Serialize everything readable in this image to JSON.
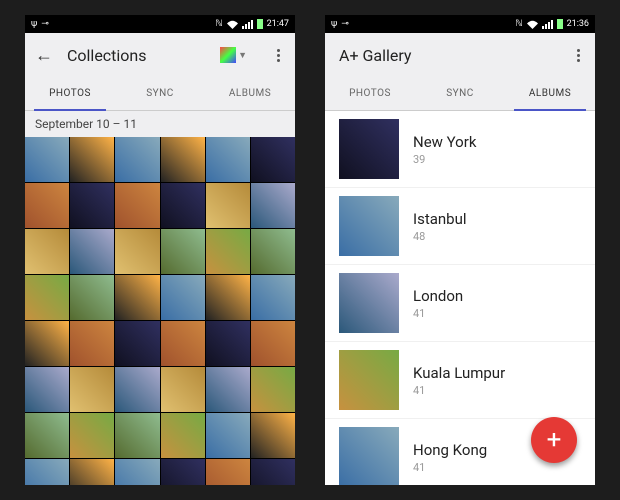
{
  "left": {
    "status": {
      "time": "21:47"
    },
    "appbar": {
      "title": "Collections"
    },
    "tabs": [
      "PHOTOS",
      "SYNC",
      "ALBUMS"
    ],
    "active_tab": 0,
    "date_range": "September 10 – 11",
    "grid": {
      "cols": 6,
      "rows": 8
    }
  },
  "right": {
    "status": {
      "time": "21:36"
    },
    "appbar": {
      "title": "A+ Gallery"
    },
    "tabs": [
      "PHOTOS",
      "SYNC",
      "ALBUMS"
    ],
    "active_tab": 2,
    "albums": [
      {
        "name": "New York",
        "count": 39
      },
      {
        "name": "Istanbul",
        "count": 48
      },
      {
        "name": "London",
        "count": 41
      },
      {
        "name": "Kuala Lumpur",
        "count": 41
      },
      {
        "name": "Hong Kong",
        "count": 41
      }
    ],
    "fab_label": "+"
  }
}
